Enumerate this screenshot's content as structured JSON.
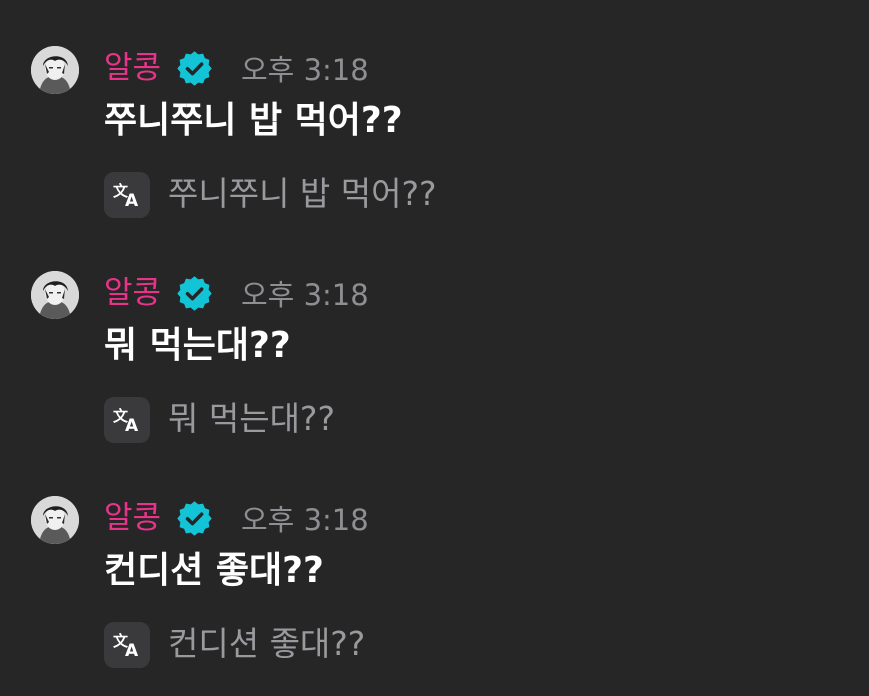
{
  "colors": {
    "background": "#262626",
    "author": "#e8338a",
    "verified_badge": "#13c3d6",
    "timestamp": "#8e8e93",
    "message_text": "#ffffff",
    "translation_text": "#9a9a9e"
  },
  "icons": {
    "verified": "verified-badge-icon",
    "translate": "translate-icon"
  },
  "messages": [
    {
      "author": "알콩",
      "time": "오후 3:18",
      "text": "쭈니쭈니 밥 먹어??",
      "translation": "쭈니쭈니 밥 먹어??"
    },
    {
      "author": "알콩",
      "time": "오후 3:18",
      "text": "뭐 먹는대??",
      "translation": "뭐 먹는대??"
    },
    {
      "author": "알콩",
      "time": "오후 3:18",
      "text": "컨디션 좋대??",
      "translation": "컨디션 좋대??"
    }
  ]
}
